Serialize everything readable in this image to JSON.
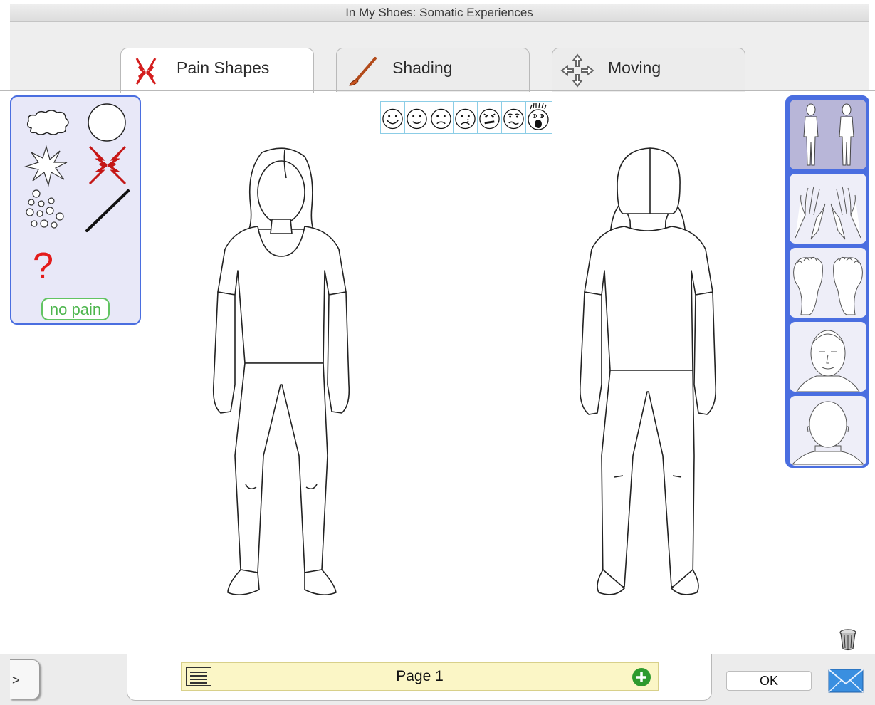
{
  "window": {
    "title": "In My Shoes: Somatic Experiences"
  },
  "tabs": [
    {
      "label": "Pain Shapes",
      "icon": "pain-shapes-icon",
      "active": true
    },
    {
      "label": "Shading",
      "icon": "paintbrush-icon",
      "active": false
    },
    {
      "label": "Moving",
      "icon": "move-arrows-icon",
      "active": false
    }
  ],
  "tools": {
    "items": [
      "cloud-shape-icon",
      "circle-shape-icon",
      "burst-shape-icon",
      "lightning-cross-icon",
      "bubbles-shape-icon",
      "line-tool-icon"
    ],
    "question_mark": "?",
    "no_pain_label": "no pain"
  },
  "faces": [
    "happy",
    "smiling",
    "sad",
    "crying",
    "angry",
    "worried",
    "shocked"
  ],
  "body_views": [
    {
      "name": "full-body",
      "selected": true
    },
    {
      "name": "hands",
      "selected": false
    },
    {
      "name": "feet",
      "selected": false
    },
    {
      "name": "face-front",
      "selected": false
    },
    {
      "name": "head-back",
      "selected": false
    }
  ],
  "bottom": {
    "expand_label": ">",
    "page_label": "Page 1",
    "ok_label": "OK"
  },
  "colors": {
    "accent_blue": "#4a6ee0",
    "panel_lavender": "#e8e8f8",
    "no_pain_green": "#4cb54c",
    "page_bar_yellow": "#fbf6c6",
    "lightning_red": "#d41e1e",
    "question_red": "#e41b1b"
  }
}
